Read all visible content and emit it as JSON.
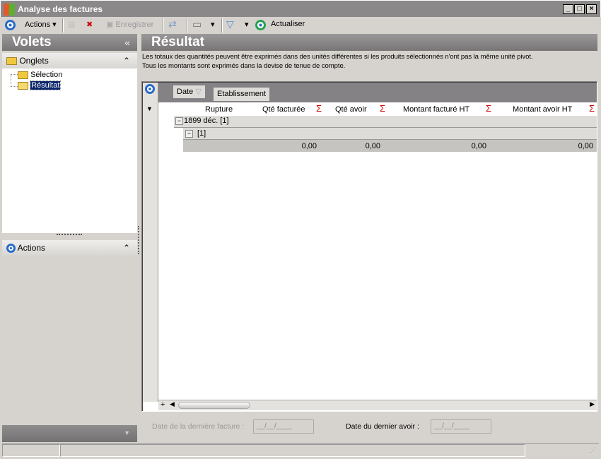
{
  "window": {
    "title": "Analyse des factures"
  },
  "toolbar": {
    "actions": "Actions",
    "save": "Enregistrer",
    "refresh": "Actualiser"
  },
  "left": {
    "title": "Volets",
    "collapse": "«",
    "tabs_section": "Onglets",
    "tree": [
      {
        "label": "Sélection"
      },
      {
        "label": "Résultat",
        "selected": true
      }
    ],
    "actions_section": "Actions"
  },
  "main": {
    "title": "Résultat",
    "note1": "Les totaux des quantités peuvent être exprimés dans des unités différentes si les produits sélectionnés n'ont pas la même unité pivot.",
    "note2": "Tous les montants sont exprimés dans la devise de tenue de compte."
  },
  "grid": {
    "group_chips": [
      "Date",
      "Etablissement"
    ],
    "columns": [
      "Rupture",
      "Qté facturée",
      "Qté avoir",
      "Montant facturé HT",
      "Montant avoir HT"
    ],
    "sigma": "Σ",
    "group1": "1899 déc. [1]",
    "group2": "[1]",
    "totals": [
      "0,00",
      "0,00",
      "0,00",
      "0,00"
    ],
    "expand": "+",
    "minus": "−"
  },
  "footer": {
    "last_invoice_label": "Date de la dernière facture :",
    "last_invoice_value": "__/__/____",
    "last_credit_label": "Date du dernier avoir :",
    "last_credit_value": "__/__/____"
  }
}
